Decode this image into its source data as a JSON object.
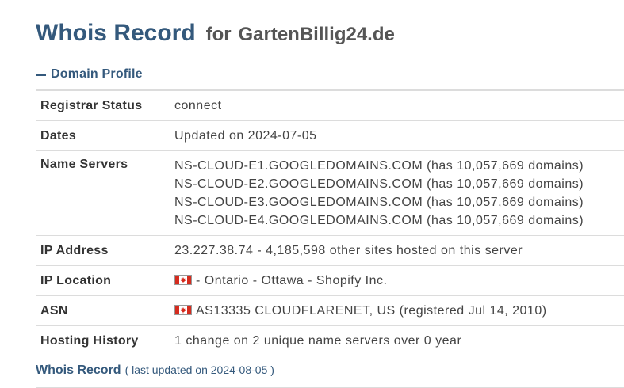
{
  "header": {
    "title": "Whois Record",
    "for_text": "for",
    "domain": "GartenBillig24.de"
  },
  "section": {
    "label": "Domain Profile",
    "icon": "minus-icon"
  },
  "profile": {
    "registrar_status": {
      "label": "Registrar Status",
      "value": "connect"
    },
    "dates": {
      "label": "Dates",
      "value": "Updated on 2024-07-05"
    },
    "name_servers": {
      "label": "Name Servers",
      "items": [
        "NS-CLOUD-E1.GOOGLEDOMAINS.COM (has 10,057,669 domains)",
        "NS-CLOUD-E2.GOOGLEDOMAINS.COM (has 10,057,669 domains)",
        "NS-CLOUD-E3.GOOGLEDOMAINS.COM (has 10,057,669 domains)",
        "NS-CLOUD-E4.GOOGLEDOMAINS.COM (has 10,057,669 domains)"
      ]
    },
    "ip_address": {
      "label": "IP Address",
      "value": "23.227.38.74 - 4,185,598 other sites hosted on this server"
    },
    "ip_location": {
      "label": "IP Location",
      "flag": "canada-flag-icon",
      "value": "- Ontario - Ottawa - Shopify Inc."
    },
    "asn": {
      "label": "ASN",
      "flag": "canada-flag-icon",
      "value": "AS13335 CLOUDFLARENET, US (registered Jul 14, 2010)"
    },
    "hosting_history": {
      "label": "Hosting History",
      "value": "1 change on 2 unique name servers over 0 year"
    }
  },
  "footer": {
    "link": "Whois Record",
    "sub": "( last updated on 2024-08-05 )"
  },
  "colors": {
    "accent": "#34597c",
    "border": "#dcdcdc",
    "flag_red": "#d52b1e"
  }
}
